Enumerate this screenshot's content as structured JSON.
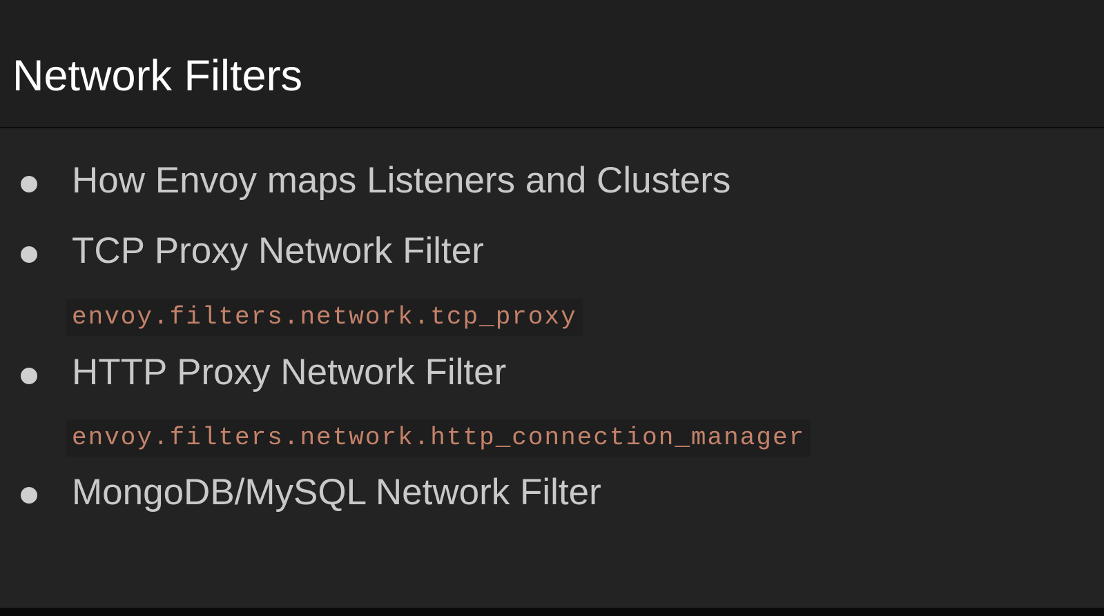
{
  "slide": {
    "title": "Network Filters",
    "items": [
      {
        "label": "How Envoy maps Listeners and Clusters"
      },
      {
        "label": "TCP Proxy Network Filter",
        "code": "envoy.filters.network.tcp_proxy"
      },
      {
        "label": "HTTP Proxy Network Filter",
        "code": "envoy.filters.network.http_connection_manager"
      },
      {
        "label": "MongoDB/MySQL Network Filter"
      }
    ]
  },
  "colors": {
    "background": "#202020",
    "title_text": "#ffffff",
    "body_text": "#c9c9c9",
    "code_text": "#c4826a",
    "bullet": "#cfcfcf"
  }
}
